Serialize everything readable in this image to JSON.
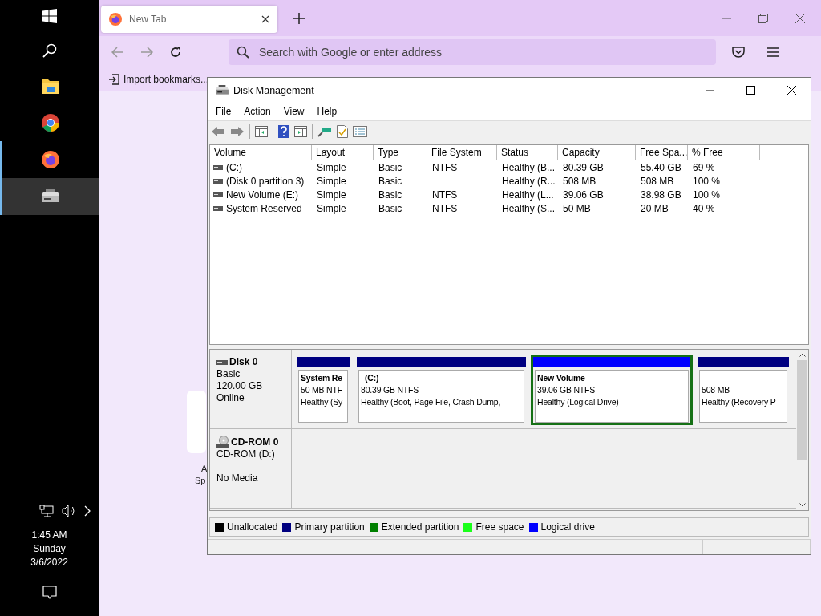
{
  "taskbar": {
    "apps": [
      {
        "kind": "explorer",
        "running": false,
        "selected": false
      },
      {
        "kind": "chrome",
        "running": false,
        "selected": false
      },
      {
        "kind": "firefox",
        "running": true,
        "selected": false
      },
      {
        "kind": "disk",
        "running": true,
        "selected": true
      }
    ],
    "clock": {
      "time": "1:45 AM",
      "day": "Sunday",
      "date": "3/6/2022"
    }
  },
  "browser": {
    "tabs": [
      {
        "title": "New Tab",
        "selected": true
      }
    ],
    "address_bar": {
      "placeholder": "Search with Google or enter address"
    },
    "bookmarks": [
      {
        "label": "Import bookmarks..."
      }
    ],
    "shortcut": {
      "title": "A",
      "subtitle": "Sp"
    }
  },
  "window": {
    "title": "Disk Management",
    "menu": [
      "File",
      "Action",
      "View",
      "Help"
    ],
    "table": {
      "columns": [
        "Volume",
        "Layout",
        "Type",
        "File System",
        "Status",
        "Capacity",
        "Free Spa...",
        "% Free"
      ],
      "rows": [
        [
          "(C:)",
          "Simple",
          "Basic",
          "NTFS",
          "Healthy (B...",
          "80.39 GB",
          "55.40 GB",
          "69 %"
        ],
        [
          "(Disk 0 partition 3)",
          "Simple",
          "Basic",
          "",
          "Healthy (R...",
          "508 MB",
          "508 MB",
          "100 %"
        ],
        [
          "New Volume (E:)",
          "Simple",
          "Basic",
          "NTFS",
          "Healthy (L...",
          "39.06 GB",
          "38.98 GB",
          "100 %"
        ],
        [
          "System Reserved",
          "Simple",
          "Basic",
          "NTFS",
          "Healthy (S...",
          "50 MB",
          "20 MB",
          "40 %"
        ]
      ]
    },
    "disks": [
      {
        "kind": "disk",
        "name": "Disk 0",
        "type": "Basic",
        "size": "120.00 GB",
        "status": "Online",
        "partitions": [
          {
            "name": "System Re",
            "size": "50 MB NTF",
            "status": "Healthy (Sy",
            "color": "#000080",
            "selected": false
          },
          {
            "name": "(C:)",
            "size": "80.39 GB NTFS",
            "status": "Healthy (Boot, Page File, Crash Dump,",
            "color": "#000080",
            "selected": false
          },
          {
            "name": "New Volume",
            "size": "39.06 GB NTFS",
            "status": "Healthy (Logical Drive)",
            "color": "#0000ff",
            "selected": true
          },
          {
            "size": "508 MB",
            "status": "Healthy (Recovery P",
            "color": "#000080",
            "selected": false
          }
        ]
      },
      {
        "kind": "cdrom",
        "name": "CD-ROM 0",
        "type": "CD-ROM (D:)",
        "status": "No Media"
      }
    ],
    "legend": [
      {
        "label": "Unallocated",
        "color": "#000000"
      },
      {
        "label": "Primary partition",
        "color": "#000080"
      },
      {
        "label": "Extended partition",
        "color": "#008000"
      },
      {
        "label": "Free space",
        "color": "#1aff1a"
      },
      {
        "label": "Logical drive",
        "color": "#0000ff"
      }
    ]
  }
}
